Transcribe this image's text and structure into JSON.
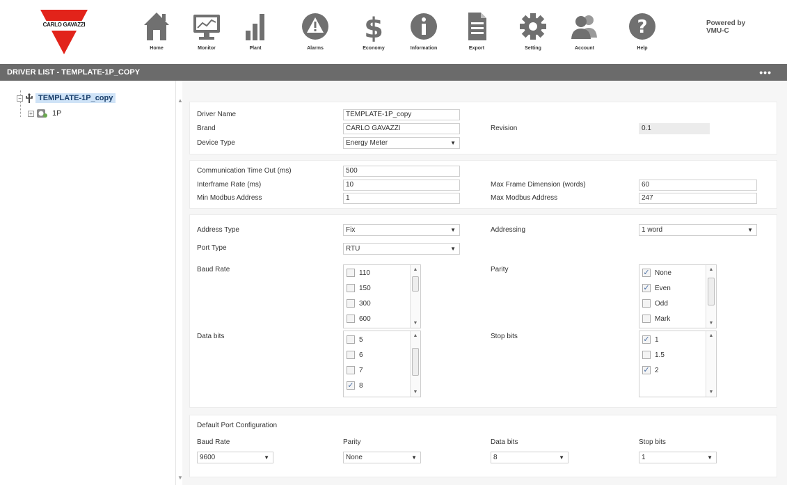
{
  "brand": {
    "logo_text": "CARLO GAVAZZI",
    "accent": "#e2231a"
  },
  "nav": [
    {
      "label": "Home",
      "icon": "home-icon"
    },
    {
      "label": "Monitor",
      "icon": "monitor-icon"
    },
    {
      "label": "Plant",
      "icon": "bar-chart-icon"
    },
    {
      "label": "Alarms",
      "icon": "alarm-icon"
    },
    {
      "label": "Economy",
      "icon": "dollar-icon"
    },
    {
      "label": "Information",
      "icon": "info-icon"
    },
    {
      "label": "Export",
      "icon": "document-icon"
    },
    {
      "label": "Setting",
      "icon": "gear-icon"
    },
    {
      "label": "Account",
      "icon": "users-icon"
    },
    {
      "label": "Help",
      "icon": "help-icon"
    }
  ],
  "powered_by": {
    "line1": "Powered by",
    "line2": "VMU-C"
  },
  "titlebar": {
    "title": "DRIVER LIST - TEMPLATE-1P_COPY",
    "menu": "•••"
  },
  "tree": {
    "root": {
      "label": "TEMPLATE-1P_copy",
      "expander": "−"
    },
    "child": {
      "label": "1P",
      "expander": "+"
    }
  },
  "form": {
    "driver_name": {
      "label": "Driver Name",
      "value": "TEMPLATE-1P_copy"
    },
    "brand": {
      "label": "Brand",
      "value": "CARLO GAVAZZI"
    },
    "revision": {
      "label": "Revision",
      "value": "0.1"
    },
    "device_type": {
      "label": "Device Type",
      "value": "Energy Meter"
    },
    "comm_timeout": {
      "label": "Communication Time Out (ms)",
      "value": "500"
    },
    "interframe": {
      "label": "Interframe Rate (ms)",
      "value": "10"
    },
    "min_modbus": {
      "label": "Min Modbus Address",
      "value": "1"
    },
    "max_frame": {
      "label": "Max Frame Dimension (words)",
      "value": "60"
    },
    "max_modbus": {
      "label": "Max Modbus Address",
      "value": "247"
    },
    "address_type": {
      "label": "Address Type",
      "value": "Fix"
    },
    "addressing": {
      "label": "Addressing",
      "value": "1 word"
    },
    "port_type": {
      "label": "Port Type",
      "value": "RTU"
    },
    "baud_rate": {
      "label": "Baud Rate",
      "options": [
        {
          "label": "110",
          "checked": false
        },
        {
          "label": "150",
          "checked": false
        },
        {
          "label": "300",
          "checked": false
        },
        {
          "label": "600",
          "checked": false
        }
      ]
    },
    "parity": {
      "label": "Parity",
      "options": [
        {
          "label": "None",
          "checked": true
        },
        {
          "label": "Even",
          "checked": true
        },
        {
          "label": "Odd",
          "checked": false
        },
        {
          "label": "Mark",
          "checked": false
        }
      ]
    },
    "data_bits": {
      "label": "Data bits",
      "options": [
        {
          "label": "5",
          "checked": false
        },
        {
          "label": "6",
          "checked": false
        },
        {
          "label": "7",
          "checked": false
        },
        {
          "label": "8",
          "checked": true
        }
      ]
    },
    "stop_bits": {
      "label": "Stop bits",
      "options": [
        {
          "label": "1",
          "checked": true
        },
        {
          "label": "1.5",
          "checked": false
        },
        {
          "label": "2",
          "checked": true
        }
      ]
    },
    "default_port": {
      "heading": "Default Port Configuration",
      "baud_rate": {
        "label": "Baud Rate",
        "value": "9600"
      },
      "parity": {
        "label": "Parity",
        "value": "None"
      },
      "data_bits": {
        "label": "Data bits",
        "value": "8"
      },
      "stop_bits": {
        "label": "Stop bits",
        "value": "1"
      }
    }
  }
}
